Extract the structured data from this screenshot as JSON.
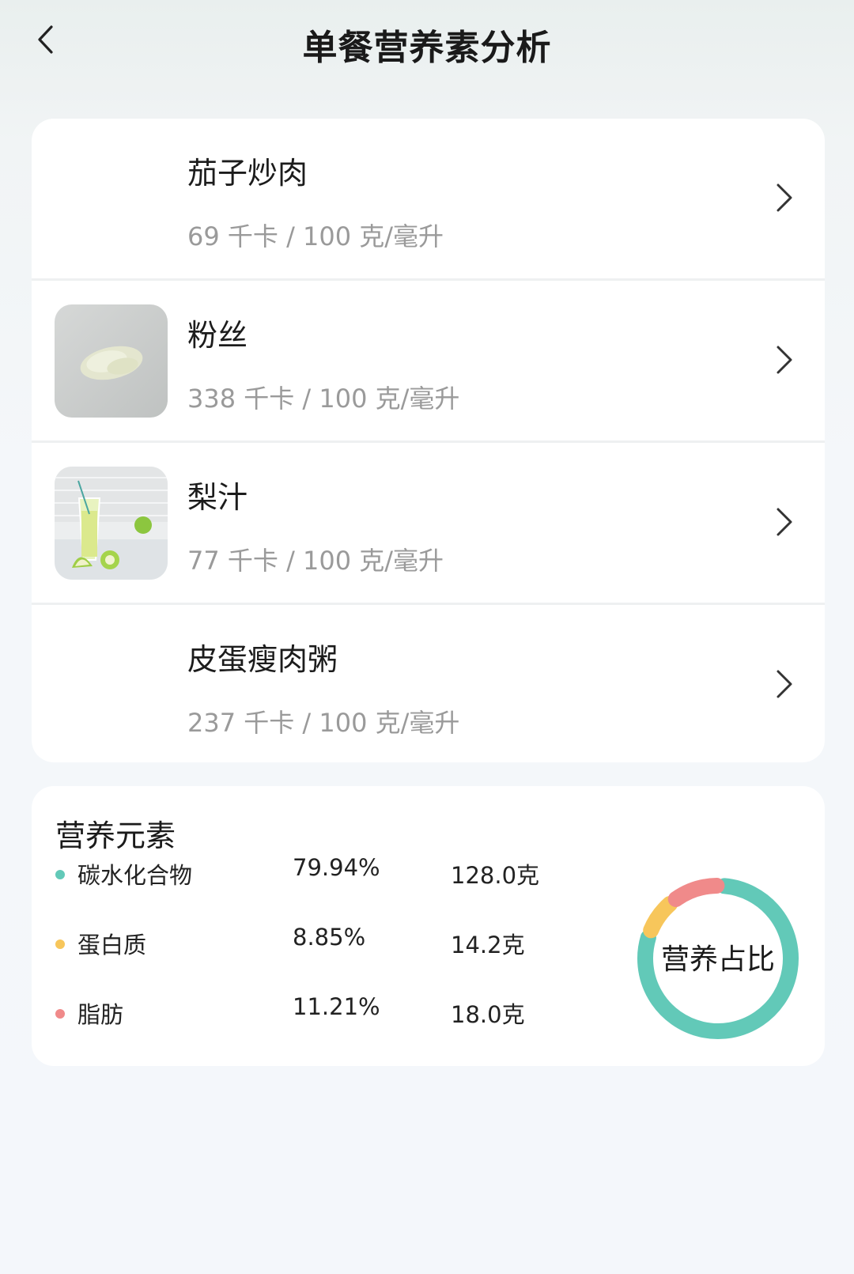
{
  "header": {
    "title": "单餐营养素分析"
  },
  "foods": [
    {
      "name": "茄子炒肉",
      "kcal": "69 千卡 / 100 克/毫升",
      "has_image": false
    },
    {
      "name": "粉丝",
      "kcal": "338 千卡 / 100 克/毫升",
      "has_image": true,
      "image": "vermicelli-photo"
    },
    {
      "name": "梨汁",
      "kcal": "77 千卡 / 100 克/毫升",
      "has_image": true,
      "image": "pear-juice-photo"
    },
    {
      "name": "皮蛋瘦肉粥",
      "kcal": "237 千卡 / 100 克/毫升",
      "has_image": false
    }
  ],
  "nutrition": {
    "title": "营养元素",
    "items": [
      {
        "name": "碳水化合物",
        "percent": "79.94%",
        "amount": "128.0克",
        "color": "#62c9b8",
        "fraction": 0.7994
      },
      {
        "name": "蛋白质",
        "percent": "8.85%",
        "amount": "14.2克",
        "color": "#f7c65b",
        "fraction": 0.0885
      },
      {
        "name": "脂肪",
        "percent": "11.21%",
        "amount": "18.0克",
        "color": "#f08a8a",
        "fraction": 0.1121
      }
    ],
    "ring_label": "营养占比"
  },
  "colors": {
    "accent": "#62c9b8",
    "muted_text": "#9a9a9a"
  }
}
